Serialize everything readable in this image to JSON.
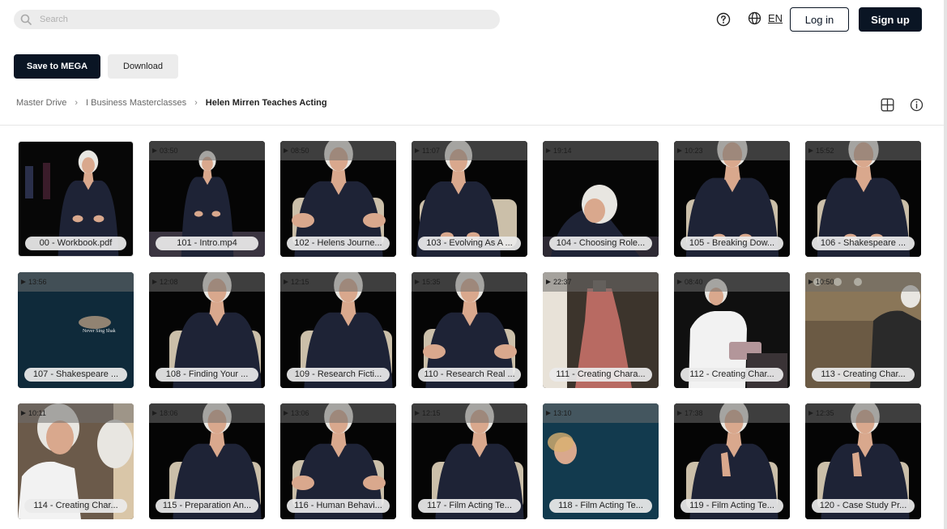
{
  "search": {
    "placeholder": "Search"
  },
  "header": {
    "language": "EN",
    "login_label": "Log in",
    "signup_label": "Sign up"
  },
  "toolbar": {
    "save_label": "Save to MEGA",
    "download_label": "Download"
  },
  "breadcrumb": [
    "Master Drive",
    "I Business Masterclasses",
    "Helen Mirren Teaches Acting"
  ],
  "files": [
    {
      "name": "00 - Workbook.pdf",
      "duration": "",
      "kind": "doc",
      "scene": "stage-sitting"
    },
    {
      "name": "101 - Intro.mp4",
      "duration": "03:50",
      "kind": "video",
      "scene": "sitting-wide"
    },
    {
      "name": "102 - Helens Journe...",
      "duration": "08:50",
      "kind": "video",
      "scene": "gesture"
    },
    {
      "name": "103 - Evolving As A ...",
      "duration": "11:07",
      "kind": "video",
      "scene": "medium-left"
    },
    {
      "name": "104 - Choosing Role...",
      "duration": "19:14",
      "kind": "video",
      "scene": "lean"
    },
    {
      "name": "105 - Breaking Dow...",
      "duration": "10:23",
      "kind": "video",
      "scene": "close"
    },
    {
      "name": "106 - Shakespeare ...",
      "duration": "15:52",
      "kind": "video",
      "scene": "close"
    },
    {
      "name": "107 - Shakespeare ...",
      "duration": "13:56",
      "kind": "video",
      "scene": "title-card"
    },
    {
      "name": "108 - Finding Your ...",
      "duration": "12:08",
      "kind": "video",
      "scene": "medium-right"
    },
    {
      "name": "109 - Research Ficti...",
      "duration": "12:15",
      "kind": "video",
      "scene": "medium-right"
    },
    {
      "name": "110 - Research Real ...",
      "duration": "15:35",
      "kind": "video",
      "scene": "gesture"
    },
    {
      "name": "111 - Creating Chara...",
      "duration": "22:37",
      "kind": "video",
      "scene": "dress"
    },
    {
      "name": "112 - Creating Char...",
      "duration": "08:40",
      "kind": "video",
      "scene": "white-shirt"
    },
    {
      "name": "113 - Creating Char...",
      "duration": "10:50",
      "kind": "video",
      "scene": "makeup"
    },
    {
      "name": "114 - Creating Char...",
      "duration": "10:11",
      "kind": "video",
      "scene": "closeup-warm"
    },
    {
      "name": "115 - Preparation An...",
      "duration": "18:06",
      "kind": "video",
      "scene": "medium-right"
    },
    {
      "name": "116 - Human Behavi...",
      "duration": "13:06",
      "kind": "video",
      "scene": "gesture"
    },
    {
      "name": "117 - Film Acting Te...",
      "duration": "12:15",
      "kind": "video",
      "scene": "medium-right"
    },
    {
      "name": "118 - Film Acting Te...",
      "duration": "13:10",
      "kind": "video",
      "scene": "blue-card"
    },
    {
      "name": "119 - Film Acting Te...",
      "duration": "17:38",
      "kind": "video",
      "scene": "chin"
    },
    {
      "name": "120 - Case Study Pr...",
      "duration": "12:35",
      "kind": "video",
      "scene": "chin"
    }
  ]
}
